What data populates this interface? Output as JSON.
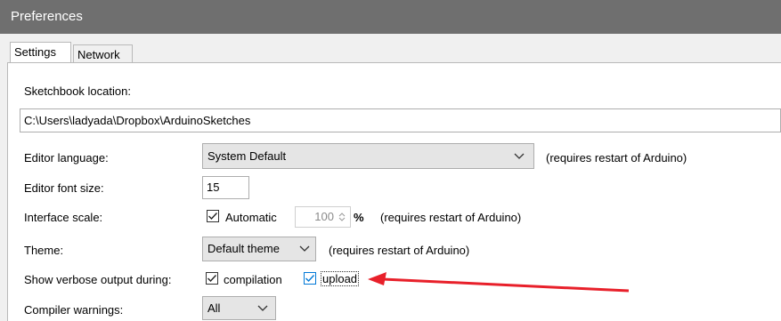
{
  "window": {
    "title": "Preferences"
  },
  "tabs": [
    {
      "label": "Settings"
    },
    {
      "label": "Network"
    }
  ],
  "sketchbook": {
    "label": "Sketchbook location:",
    "value": "C:\\Users\\ladyada\\Dropbox\\ArduinoSketches"
  },
  "editor_language": {
    "label": "Editor language:",
    "selected": "System Default",
    "note": "(requires restart of Arduino)"
  },
  "editor_font_size": {
    "label": "Editor font size:",
    "value": "15"
  },
  "interface_scale": {
    "label": "Interface scale:",
    "automatic_label": "Automatic",
    "automatic_checked": true,
    "value": "100",
    "unit": "%",
    "note": "(requires restart of Arduino)"
  },
  "theme": {
    "label": "Theme:",
    "selected": "Default theme",
    "note": "(requires restart of Arduino)"
  },
  "verbose": {
    "label": "Show verbose output during:",
    "compilation_label": "compilation",
    "compilation_checked": true,
    "upload_label": "upload",
    "upload_checked": true
  },
  "compiler_warnings": {
    "label": "Compiler warnings:",
    "selected": "All"
  },
  "colors": {
    "titlebar": "#6f6f6f",
    "annotation_arrow": "#e8202a",
    "focus_border": "#0078d7"
  },
  "icons": [
    "chevron-down-icon",
    "checkmark-icon",
    "spinner-arrows-icon",
    "red-arrow-annotation"
  ]
}
